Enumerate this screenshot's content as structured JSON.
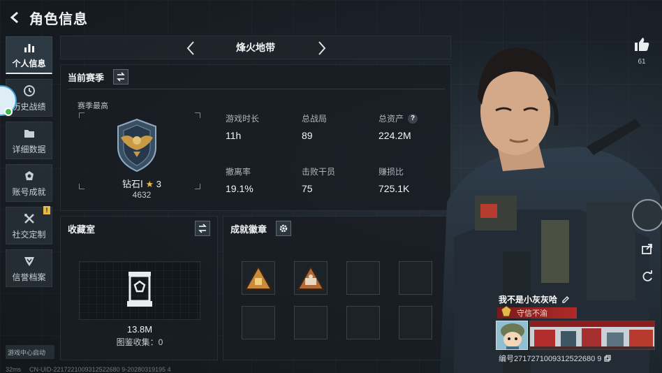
{
  "header": {
    "title": "角色信息"
  },
  "sidebar": {
    "items": [
      {
        "label": "个人信息",
        "icon": "bar-chart-icon",
        "active": true
      },
      {
        "label": "历史战绩",
        "icon": "history-icon"
      },
      {
        "label": "详细数据",
        "icon": "folder-icon"
      },
      {
        "label": "账号成就",
        "icon": "achievement-icon"
      },
      {
        "label": "社交定制",
        "icon": "tools-icon",
        "badge": "!"
      },
      {
        "label": "信誉档案",
        "icon": "reputation-icon"
      }
    ]
  },
  "launch_tag": "游戏中心启动",
  "bottom_bar": {
    "ping": "32ms",
    "uid": "CN-UID-2217221009312522680 9-20280319195 4"
  },
  "season": {
    "title": "烽火地带"
  },
  "season_panel": {
    "title": "当前赛季",
    "highest_label": "赛季最高",
    "rank_name": "钻石Ⅰ",
    "rank_stars": "3",
    "rank_points": "4632",
    "stats": [
      {
        "label": "游戏时长",
        "value": "11h"
      },
      {
        "label": "总战局",
        "value": "89"
      },
      {
        "label": "总资产",
        "value": "224.2M",
        "help": "?"
      },
      {
        "label": "撤离率",
        "value": "19.1%"
      },
      {
        "label": "击败干员",
        "value": "75"
      },
      {
        "label": "赚损比",
        "value": "725.1K"
      }
    ]
  },
  "collection_panel": {
    "title": "收藏室",
    "value": "13.8M",
    "count_text": "图鉴收集：0"
  },
  "badges_panel": {
    "title": "成就徽章"
  },
  "character": {
    "like_count": "61",
    "player_name": "我不是小灰灰哈",
    "title": "守信不渝",
    "player_id": "编号2717271009312522680 9"
  },
  "colors": {
    "accent_gold": "#e5b94a",
    "title_red": "#b02a2a"
  }
}
